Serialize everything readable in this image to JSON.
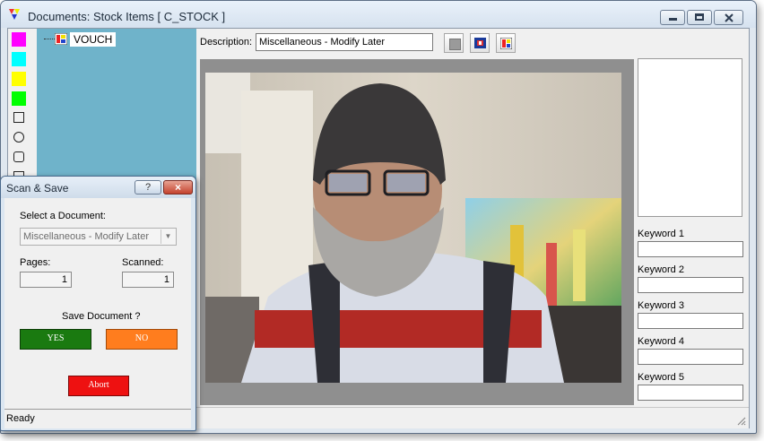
{
  "window": {
    "title": "Documents: Stock Items [ C_STOCK ]",
    "controls": [
      "minimize",
      "maximize",
      "close"
    ]
  },
  "palette": {
    "colors": [
      "#ff00ff",
      "#00ffff",
      "#ffff00",
      "#00ff00"
    ],
    "shapes": [
      "square-outline-icon",
      "circle-outline-icon",
      "rounded-rect-icon"
    ]
  },
  "tree": {
    "nodes": [
      {
        "label": "VOUCH",
        "icon": "document-node-icon"
      }
    ]
  },
  "description": {
    "label": "Description:",
    "value": "Miscellaneous - Modify Later"
  },
  "toolbar": {
    "buttons": [
      "gray-square-icon",
      "flag-icon",
      "color-blocks-icon"
    ]
  },
  "keywords": [
    {
      "label": "Keyword 1",
      "value": ""
    },
    {
      "label": "Keyword 2",
      "value": ""
    },
    {
      "label": "Keyword 3",
      "value": ""
    },
    {
      "label": "Keyword 4",
      "value": ""
    },
    {
      "label": "Keyword 5",
      "value": ""
    }
  ],
  "dialog": {
    "title": "Scan & Save",
    "help": "?",
    "close": "×",
    "select_label": "Select a Document:",
    "select_value": "Miscellaneous - Modify Later",
    "pages_label": "Pages:",
    "pages_value": "1",
    "scanned_label": "Scanned:",
    "scanned_value": "1",
    "save_prompt": "Save Document ?",
    "yes_label": "YES",
    "no_label": "NO",
    "abort_label": "Abort",
    "status": "Ready",
    "colors": {
      "yes": "#1a7a10",
      "no": "#ff7d1e",
      "abort": "#ee1111"
    }
  }
}
